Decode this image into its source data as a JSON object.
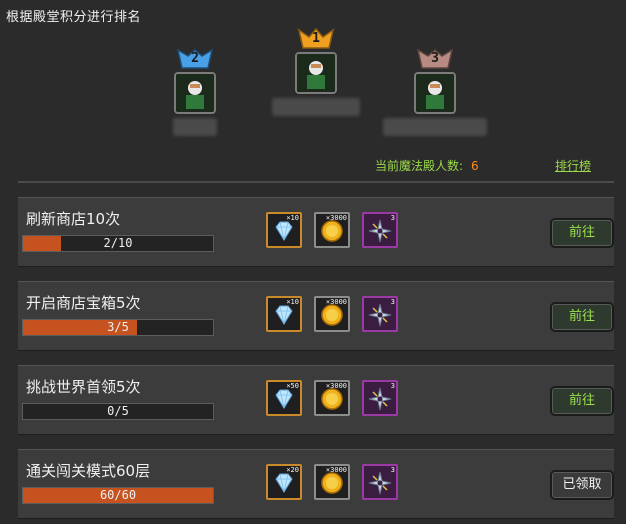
{
  "header": {
    "title": "根据殿堂积分进行排名"
  },
  "podium": [
    {
      "rank": "2",
      "medal_color": "#4aa0e6"
    },
    {
      "rank": "1",
      "medal_color": "#f0a020"
    },
    {
      "rank": "3",
      "medal_color": "#b78a82"
    }
  ],
  "info": {
    "label": "当前魔法殿人数:",
    "count": "6",
    "ranking_link": "排行榜"
  },
  "quests": [
    {
      "title": "刷新商店10次",
      "progress_text": "2/10",
      "progress": 0.2,
      "rewards": [
        "×10",
        "×3000",
        "3"
      ],
      "button": "前往",
      "claimed": false
    },
    {
      "title": "开启商店宝箱5次",
      "progress_text": "3/5",
      "progress": 0.6,
      "rewards": [
        "×10",
        "×3000",
        "3"
      ],
      "button": "前往",
      "claimed": false
    },
    {
      "title": "挑战世界首领5次",
      "progress_text": "0/5",
      "progress": 0.0,
      "rewards": [
        "×50",
        "×3000",
        "3"
      ],
      "button": "前往",
      "claimed": false
    },
    {
      "title": "通关闯关模式60层",
      "progress_text": "60/60",
      "progress": 1.0,
      "rewards": [
        "×20",
        "×3000",
        "3"
      ],
      "button": "已领取",
      "claimed": true
    }
  ],
  "reward_icons": [
    "diamond-icon",
    "gold-coin-icon",
    "shuriken-icon"
  ],
  "colors": {
    "accent_green": "#9bd84a",
    "count_orange": "#ff8a1e",
    "progress_fill": "#c5521f"
  }
}
